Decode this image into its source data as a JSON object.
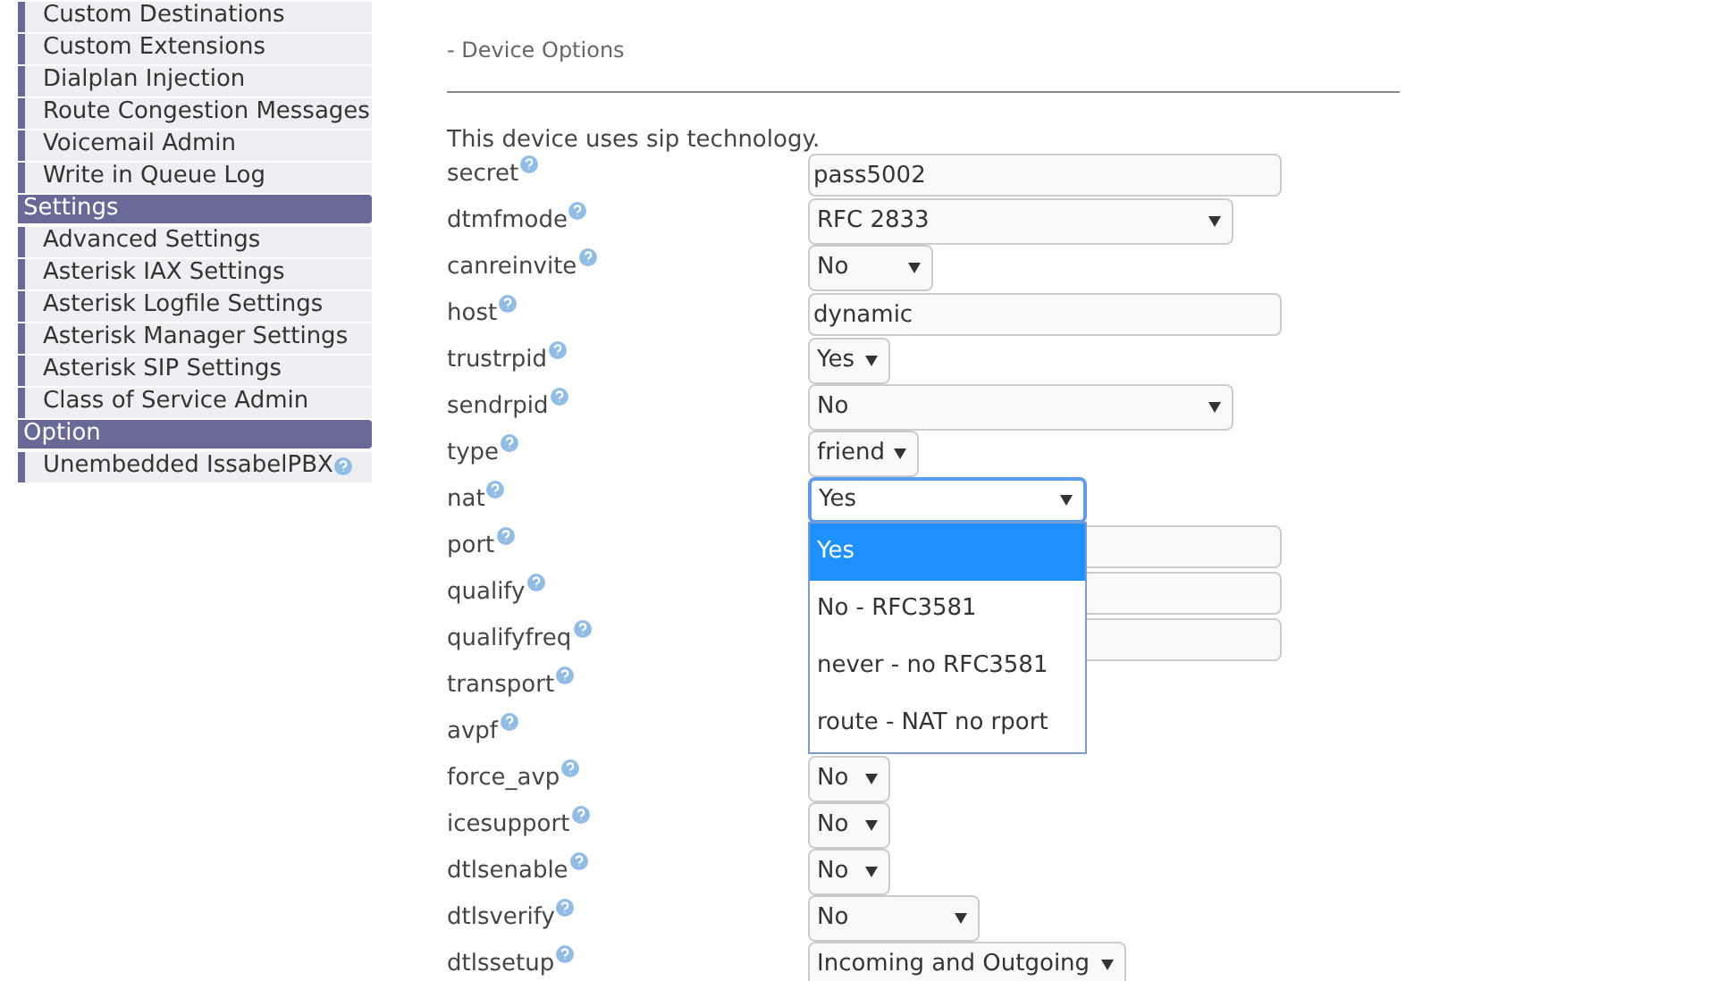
{
  "sidebar": {
    "items": [
      {
        "kind": "item",
        "label": "Custom Destinations"
      },
      {
        "kind": "item",
        "label": "Custom Extensions"
      },
      {
        "kind": "item",
        "label": "Dialplan Injection"
      },
      {
        "kind": "item",
        "label": "Route Congestion Messages"
      },
      {
        "kind": "item",
        "label": "Voicemail Admin"
      },
      {
        "kind": "item",
        "label": "Write in Queue Log"
      },
      {
        "kind": "header",
        "label": "Settings"
      },
      {
        "kind": "item",
        "label": "Advanced Settings"
      },
      {
        "kind": "item",
        "label": "Asterisk IAX Settings"
      },
      {
        "kind": "item",
        "label": "Asterisk Logfile Settings"
      },
      {
        "kind": "item",
        "label": "Asterisk Manager Settings"
      },
      {
        "kind": "item",
        "label": "Asterisk SIP Settings"
      },
      {
        "kind": "item",
        "label": "Class of Service Admin"
      },
      {
        "kind": "header",
        "label": "Option"
      },
      {
        "kind": "item",
        "label": "Unembedded IssabelPBX",
        "help": true
      }
    ]
  },
  "section": {
    "title": "- Device Options",
    "note": "This device uses sip technology.",
    "rows": [
      {
        "label": "secret",
        "kind": "text",
        "value": "pass5002"
      },
      {
        "label": "dtmfmode",
        "kind": "select",
        "value": "RFC 2833"
      },
      {
        "label": "canreinvite",
        "kind": "select",
        "value": "No"
      },
      {
        "label": "host",
        "kind": "text",
        "value": "dynamic"
      },
      {
        "label": "trustrpid",
        "kind": "select",
        "value": "Yes"
      },
      {
        "label": "sendrpid",
        "kind": "select",
        "value": "No"
      },
      {
        "label": "type",
        "kind": "select",
        "value": "friend"
      },
      {
        "label": "nat",
        "kind": "select",
        "value": "Yes",
        "open": true,
        "options": [
          {
            "label": "Yes",
            "selected": true
          },
          {
            "label": "No - RFC3581",
            "selected": false
          },
          {
            "label": "never - no RFC3581",
            "selected": false
          },
          {
            "label": "route - NAT no rport",
            "selected": false
          }
        ]
      },
      {
        "label": "port",
        "kind": "text"
      },
      {
        "label": "qualify",
        "kind": "text"
      },
      {
        "label": "qualifyfreq",
        "kind": "text"
      },
      {
        "label": "transport",
        "kind": "covered"
      },
      {
        "label": "avpf",
        "kind": "covered"
      },
      {
        "label": "force_avp",
        "kind": "select",
        "value": "No"
      },
      {
        "label": "icesupport",
        "kind": "select",
        "value": "No"
      },
      {
        "label": "dtlsenable",
        "kind": "select",
        "value": "No"
      },
      {
        "label": "dtlsverify",
        "kind": "select",
        "value": "No"
      },
      {
        "label": "dtlssetup",
        "kind": "select",
        "value": "Incoming and Outgoing"
      }
    ]
  }
}
